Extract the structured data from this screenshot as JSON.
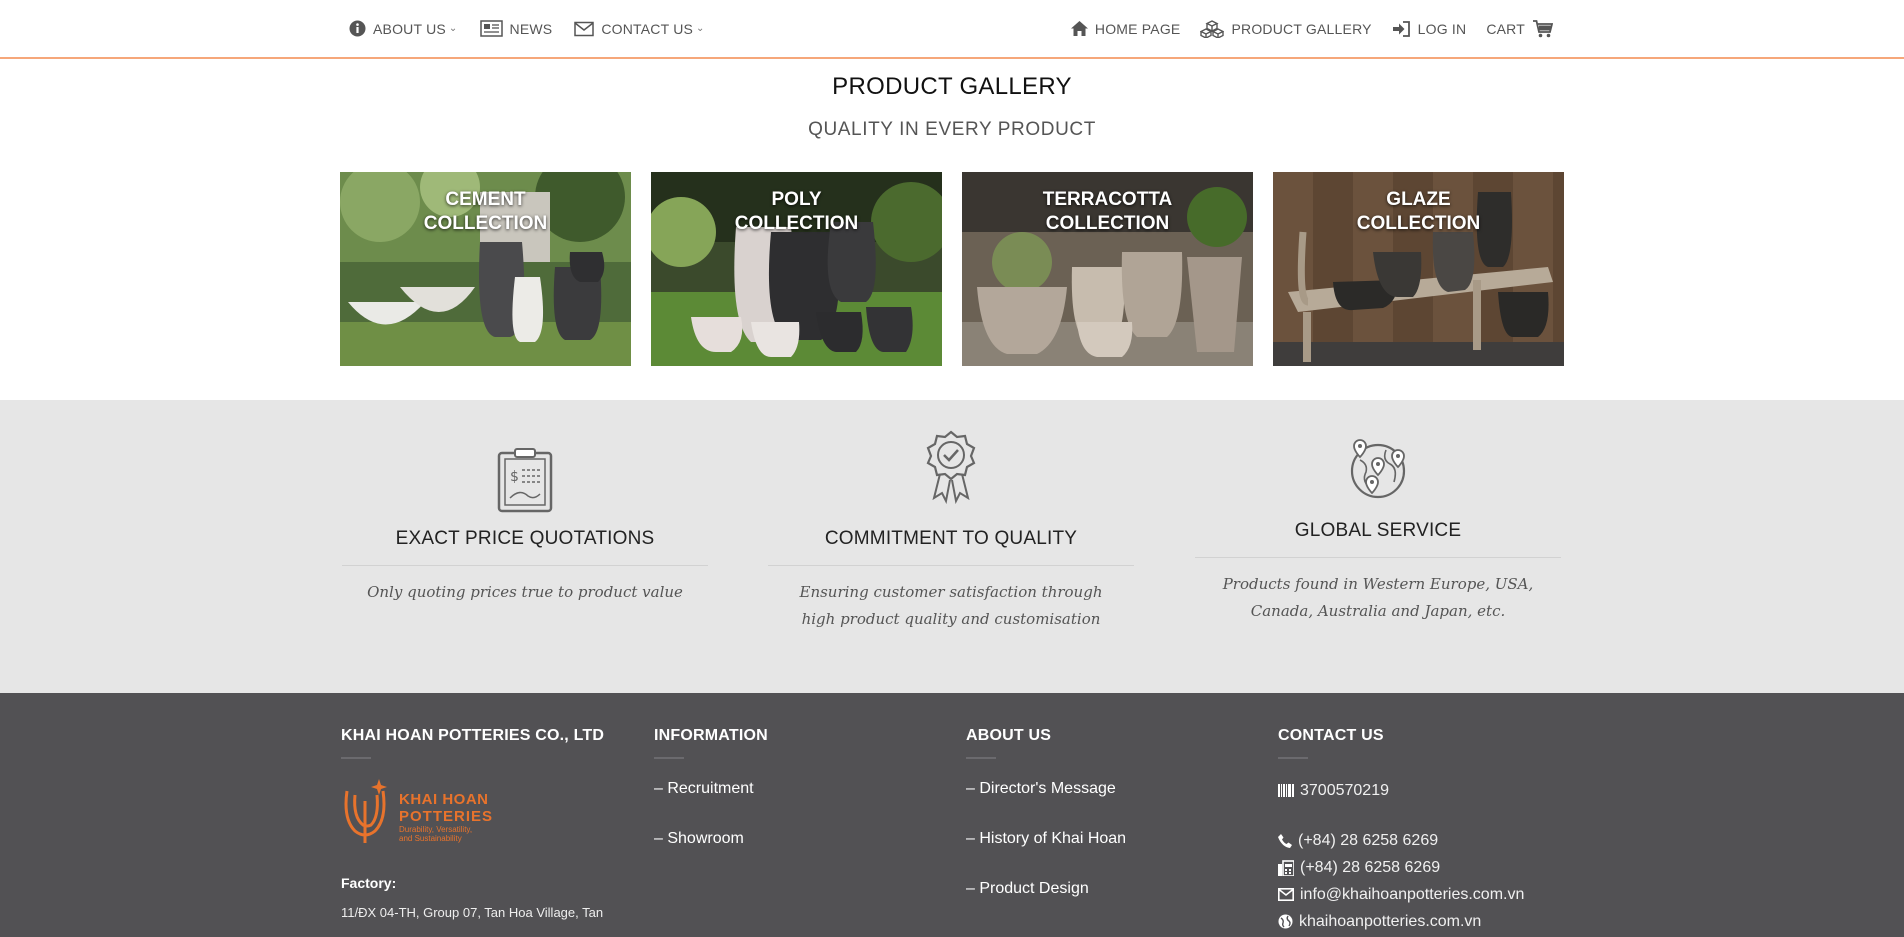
{
  "header": {
    "left_nav": [
      {
        "label": "ABOUT US",
        "icon": "info-circle-icon",
        "dropdown": true
      },
      {
        "label": "NEWS",
        "icon": "newspaper-icon",
        "dropdown": false
      },
      {
        "label": "CONTACT US",
        "icon": "envelope-icon",
        "dropdown": true
      }
    ],
    "right_nav": [
      {
        "label": "HOME PAGE",
        "icon": "home-icon"
      },
      {
        "label": "PRODUCT GALLERY",
        "icon": "cubes-icon"
      },
      {
        "label": "LOG IN",
        "icon": "sign-in-icon"
      },
      {
        "label": "CART",
        "icon": "cart-icon"
      }
    ]
  },
  "gallery": {
    "title": "PRODUCT GALLERY",
    "subtitle": "QUALITY IN EVERY PRODUCT",
    "collections": [
      {
        "line1": "CEMENT",
        "line2": "COLLECTION"
      },
      {
        "line1": "POLY",
        "line2": "COLLECTION"
      },
      {
        "line1": "TERRACOTTA",
        "line2": "COLLECTION"
      },
      {
        "line1": "GLAZE",
        "line2": "COLLECTION"
      }
    ]
  },
  "features": [
    {
      "title": "EXACT PRICE QUOTATIONS",
      "text": "Only quoting prices true to product value",
      "icon": "clipboard-price-icon"
    },
    {
      "title": "COMMITMENT TO QUALITY",
      "text": "Ensuring customer satisfaction through high product quality and customisation",
      "icon": "quality-badge-icon"
    },
    {
      "title": "GLOBAL SERVICE",
      "text": "Products found in Western Europe, USA, Canada, Australia and Japan, etc.",
      "icon": "globe-pins-icon"
    }
  ],
  "footer": {
    "company": {
      "title": "KHAI HOAN POTTERIES CO., LTD",
      "logo_text_1": "KHAI HOAN",
      "logo_text_2": "POTTERIES",
      "logo_tagline_1": "Durability, Versatility,",
      "logo_tagline_2": "and Sustainability",
      "factory_label": "Factory:",
      "address": "11/ĐX 04-TH, Group 07, Tan Hoa Village, Tan"
    },
    "information": {
      "title": "INFORMATION",
      "links": [
        "– Recruitment",
        "– Showroom"
      ]
    },
    "about": {
      "title": "ABOUT US",
      "links": [
        "– Director's Message",
        "– History of Khai Hoan",
        "– Product Design"
      ]
    },
    "contact": {
      "title": "CONTACT US",
      "tax_id": "3700570219",
      "phone": "(+84) 28 6258 6269",
      "fax": "(+84) 28 6258 6269",
      "email": "info@khaihoanpotteries.com.vn",
      "website": "khaihoanpotteries.com.vn"
    }
  },
  "colors": {
    "accent": "#e8732c",
    "footer_bg": "#525154",
    "features_bg": "#e6e6e6",
    "header_border": "#f6a77a"
  }
}
